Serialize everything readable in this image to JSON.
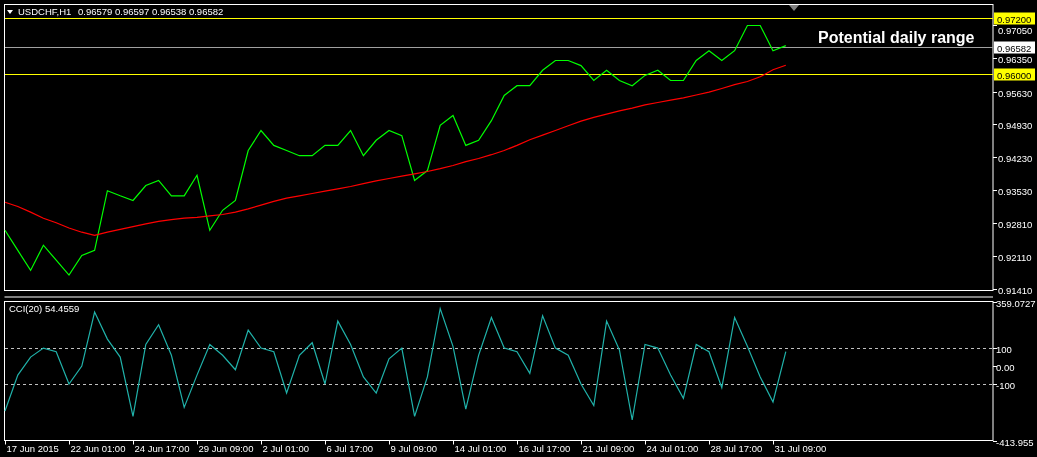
{
  "chart_header": {
    "title": "USDCHF,H1",
    "quote": "0.96579 0.96597 0.96538 0.96582"
  },
  "price_chart": {
    "chart_data": {
      "type": "line",
      "ylim": [
        0.9137,
        0.975
      ],
      "series": [
        {
          "color": "#00ff00",
          "values": [
            0.9266,
            0.9223,
            0.918,
            0.9234,
            0.9202,
            0.917,
            0.9212,
            0.9223,
            0.9351,
            0.934,
            0.933,
            0.9362,
            0.9373,
            0.934,
            0.934,
            0.9384,
            0.9266,
            0.9309,
            0.933,
            0.9437,
            0.948,
            0.9448,
            0.9437,
            0.9426,
            0.9426,
            0.9448,
            0.9448,
            0.948,
            0.9426,
            0.9459,
            0.948,
            0.9469,
            0.9373,
            0.9394,
            0.9491,
            0.9512,
            0.9448,
            0.9459,
            0.9501,
            0.9555,
            0.9576,
            0.9576,
            0.9609,
            0.963,
            0.963,
            0.9619,
            0.9587,
            0.9609,
            0.9587,
            0.9576,
            0.9598,
            0.9609,
            0.9587,
            0.9587,
            0.963,
            0.9651,
            0.963,
            0.9651,
            0.9705,
            0.9705,
            0.9651,
            0.9662
          ]
        },
        {
          "color": "#ff0000",
          "values": [
            0.9326,
            0.9317,
            0.9305,
            0.9292,
            0.9282,
            0.9271,
            0.9262,
            0.9255,
            0.9262,
            0.9268,
            0.9274,
            0.928,
            0.9285,
            0.9289,
            0.9292,
            0.9294,
            0.9297,
            0.93,
            0.9305,
            0.9312,
            0.932,
            0.9328,
            0.9335,
            0.934,
            0.9345,
            0.935,
            0.9355,
            0.936,
            0.9366,
            0.9372,
            0.9377,
            0.9382,
            0.9387,
            0.9392,
            0.9398,
            0.9405,
            0.9413,
            0.942,
            0.9428,
            0.9437,
            0.9448,
            0.946,
            0.947,
            0.948,
            0.949,
            0.95,
            0.9508,
            0.9515,
            0.9522,
            0.9528,
            0.9535,
            0.954,
            0.9545,
            0.955,
            0.9556,
            0.9562,
            0.957,
            0.9578,
            0.9585,
            0.9595,
            0.961,
            0.962
          ]
        }
      ],
      "yticks": [
        {
          "value": 0.9705,
          "label": "0.97050"
        },
        {
          "value": 0.9635,
          "label": "0.96350"
        },
        {
          "value": 0.9563,
          "label": "0.95630"
        },
        {
          "value": 0.9493,
          "label": "0.94930"
        },
        {
          "value": 0.9423,
          "label": "0.94230"
        },
        {
          "value": 0.9353,
          "label": "0.93530"
        },
        {
          "value": 0.9281,
          "label": "0.92810"
        },
        {
          "value": 0.9211,
          "label": "0.92110"
        },
        {
          "value": 0.9141,
          "label": "0.91410"
        }
      ],
      "ref_lines": [
        {
          "axis": "y",
          "value": 0.972,
          "label": "0.97200",
          "color": "#ffff00"
        },
        {
          "axis": "y",
          "value": 0.96582,
          "label": "0.96582",
          "color": "#a0a0a0"
        },
        {
          "axis": "y",
          "value": 0.96,
          "label": "0.96000",
          "color": "#ffff00"
        }
      ],
      "annotations": [
        "Potential daily range"
      ]
    }
  },
  "cci_chart": {
    "title": "CCI(20) 54.4559",
    "chart_data": {
      "type": "line",
      "ylim": [
        -413.955,
        359.0727
      ],
      "series": [
        {
          "color": "#20b2aa",
          "values": [
            -250,
            -50,
            50,
            100,
            80,
            -100,
            0,
            300,
            150,
            50,
            -280,
            120,
            230,
            60,
            -230,
            -50,
            120,
            60,
            -20,
            200,
            100,
            80,
            -150,
            60,
            130,
            -100,
            250,
            120,
            -60,
            -150,
            40,
            100,
            -280,
            -60,
            320,
            110,
            -240,
            60,
            270,
            100,
            80,
            -40,
            280,
            100,
            60,
            -100,
            -220,
            250,
            90,
            -300,
            120,
            100,
            -50,
            -180,
            120,
            80,
            -120,
            270,
            110,
            -60,
            -200,
            80
          ]
        }
      ],
      "yticks": [
        {
          "value": 359.0727,
          "label": "359.0727"
        },
        {
          "value": 100,
          "label": "100"
        },
        {
          "value": 0,
          "label": "0.00"
        },
        {
          "value": -100,
          "label": "-100"
        },
        {
          "value": -413.955,
          "label": "-413.955"
        }
      ],
      "ref_lines": [
        {
          "axis": "y",
          "value": 100
        },
        {
          "axis": "y",
          "value": -100
        }
      ]
    }
  },
  "time_axis": {
    "labels": [
      "17 Jun 2015",
      "22 Jun 01:00",
      "24 Jun 17:00",
      "29 Jun 09:00",
      "2 Jul 01:00",
      "6 Jul 17:00",
      "9 Jul 09:00",
      "14 Jul 01:00",
      "16 Jul 17:00",
      "21 Jul 09:00",
      "24 Jul 01:00",
      "28 Jul 17:00",
      "31 Jul 09:00"
    ]
  }
}
